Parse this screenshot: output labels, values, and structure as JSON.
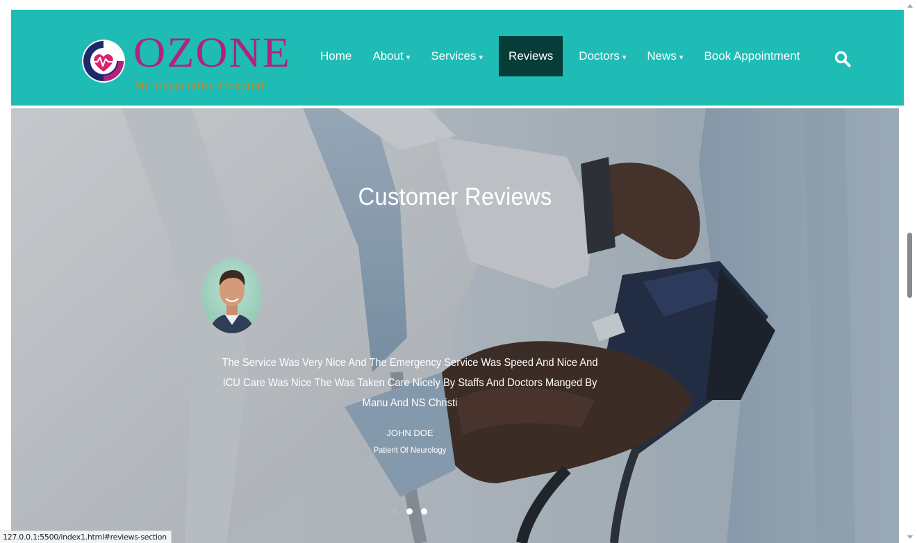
{
  "colors": {
    "nav_bg": "#1ebcb4",
    "nav_active_bg": "#063d39",
    "brand_pink": "#b3217f",
    "brand_gold": "#b68a3b",
    "logo_navy": "#1d2a6a",
    "dot_inactive": "#b7b7b7",
    "dot_active": "#ffffff"
  },
  "brand": {
    "name": "OZONE",
    "tagline": "Multispeciality Hospital",
    "logo_icon": "heartbeat-logo-icon"
  },
  "nav": {
    "items": [
      {
        "label": "Home",
        "has_caret": false
      },
      {
        "label": "About",
        "has_caret": true
      },
      {
        "label": "Services",
        "has_caret": true
      },
      {
        "label": "Reviews",
        "has_caret": false,
        "active": true
      },
      {
        "label": "Doctors",
        "has_caret": true
      },
      {
        "label": "News",
        "has_caret": true
      },
      {
        "label": "Book Appointment",
        "has_caret": false
      }
    ],
    "caret_glyph": "▾",
    "search_icon": "search-icon"
  },
  "reviews": {
    "title": "Customer Reviews",
    "text": "The Service Was Very Nice And The Emergency Service Was Speed And Nice And ICU Care Was Nice The Was Taken Care Nicely By Staffs And Doctors Manged By Manu And NS Christi",
    "reviewer_name": "JOHN DOE",
    "reviewer_role": "Patient Of Neurology",
    "avatar_icon": "reviewer-avatar",
    "slides": 3,
    "active_slide": 2
  },
  "status_bar": {
    "url": "127.0.0.1:5500/index1.html#reviews-section"
  }
}
